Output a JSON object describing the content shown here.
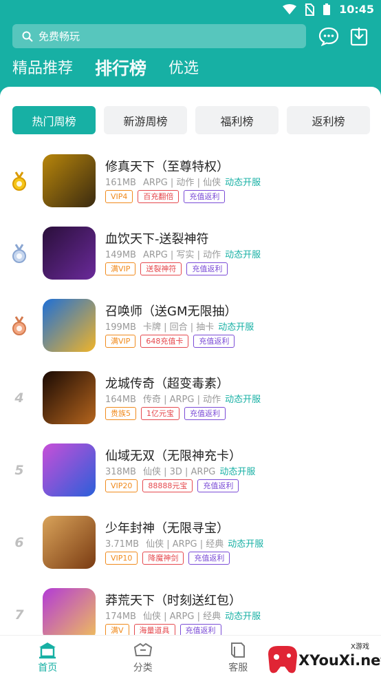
{
  "status": {
    "time": "10:45"
  },
  "search": {
    "placeholder": "免费畅玩"
  },
  "top_tabs": [
    "精品推荐",
    "排行榜",
    "优选"
  ],
  "segments": [
    "热门周榜",
    "新游周榜",
    "福利榜",
    "返利榜"
  ],
  "games": [
    {
      "rank": "",
      "medal": "gold",
      "title": "修真天下（至尊特权）",
      "size": "161MB",
      "genres": "ARPG | 动作 | 仙侠",
      "open": "动态开服",
      "tags": [
        [
          "VIP4",
          "o"
        ],
        [
          "百充翻倍",
          "r"
        ],
        [
          "充值返利",
          "p"
        ]
      ],
      "colors": [
        "#b8860b",
        "#3a2a10"
      ]
    },
    {
      "rank": "",
      "medal": "silver",
      "title": "血饮天下-送裂神符",
      "size": "149MB",
      "genres": "ARPG | 写实 | 动作",
      "open": "动态开服",
      "tags": [
        [
          "满VIP",
          "o"
        ],
        [
          "送裂神符",
          "r"
        ],
        [
          "充值返利",
          "p"
        ]
      ],
      "colors": [
        "#2a0f3a",
        "#6a2a9a"
      ]
    },
    {
      "rank": "",
      "medal": "bronze",
      "title": "召唤师（送GM无限抽）",
      "size": "199MB",
      "genres": "卡牌 | 回合 | 抽卡",
      "open": "动态开服",
      "tags": [
        [
          "满VIP",
          "o"
        ],
        [
          "648充值卡",
          "r"
        ],
        [
          "充值返利",
          "p"
        ]
      ],
      "colors": [
        "#1e6fd6",
        "#f0b429"
      ]
    },
    {
      "rank": "4",
      "medal": "",
      "title": "龙城传奇（超变毒素）",
      "size": "164MB",
      "genres": "传奇 | ARPG | 动作",
      "open": "动态开服",
      "tags": [
        [
          "贵族5",
          "o"
        ],
        [
          "1亿元宝",
          "r"
        ],
        [
          "充值返利",
          "p"
        ]
      ],
      "colors": [
        "#1a0a04",
        "#b5651d"
      ]
    },
    {
      "rank": "5",
      "medal": "",
      "title": "仙域无双（无限神充卡）",
      "size": "318MB",
      "genres": "仙侠 | 3D | ARPG",
      "open": "动态开服",
      "tags": [
        [
          "VIP20",
          "o"
        ],
        [
          "88888元宝",
          "r"
        ],
        [
          "充值返利",
          "p"
        ]
      ],
      "colors": [
        "#c84fd8",
        "#2b5fd9"
      ]
    },
    {
      "rank": "6",
      "medal": "",
      "title": "少年封神（无限寻宝）",
      "size": "3.71MB",
      "genres": "仙侠 | ARPG | 经典",
      "open": "动态开服",
      "tags": [
        [
          "VIP10",
          "o"
        ],
        [
          "降魔神剑",
          "r"
        ],
        [
          "充值返利",
          "p"
        ]
      ],
      "colors": [
        "#d9a35a",
        "#7a3b12"
      ]
    },
    {
      "rank": "7",
      "medal": "",
      "title": "莽荒天下（时刻送红包）",
      "size": "174MB",
      "genres": "仙侠 | ARPG | 经典",
      "open": "动态开服",
      "tags": [
        [
          "满V",
          "o"
        ],
        [
          "海量道具",
          "r"
        ],
        [
          "充值返利",
          "p"
        ]
      ],
      "colors": [
        "#b23bd6",
        "#f0c05a"
      ]
    }
  ],
  "bottom_nav": [
    "首页",
    "分类",
    "客服"
  ],
  "watermark": {
    "brand": "XYouXi.net",
    "small": "X游戏"
  },
  "colors": {
    "accent": "#17b0a4"
  }
}
